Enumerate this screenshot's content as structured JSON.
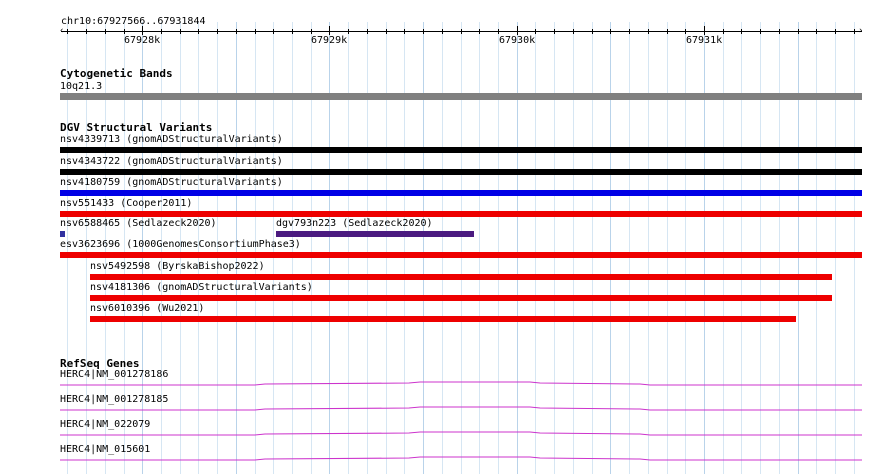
{
  "ruler": {
    "location": "chr10:67927566..67931844",
    "ticks": [
      {
        "label": "67928k",
        "pos": 67928000
      },
      {
        "label": "67929k",
        "pos": 67929000
      },
      {
        "label": "67930k",
        "pos": 67930000
      },
      {
        "label": "67931k",
        "pos": 67931000
      }
    ],
    "view_start": 67927566,
    "view_end": 67931844
  },
  "tracks": {
    "cytoband": {
      "title": "Cytogenetic Bands",
      "band_label": "10q21.3",
      "color": "#808080"
    },
    "dgv": {
      "title": "DGV Structural Variants",
      "features": [
        {
          "label": "nsv4339713 (gnomADStructuralVariants)",
          "start": 67927400,
          "end": 67931900,
          "color": "#000000",
          "row": 0
        },
        {
          "label": "nsv4343722 (gnomADStructuralVariants)",
          "start": 67927400,
          "end": 67931900,
          "color": "#000000",
          "row": 1
        },
        {
          "label": "nsv4180759 (gnomADStructuralVariants)",
          "start": 67927400,
          "end": 67931900,
          "color": "#0000e6",
          "row": 2
        },
        {
          "label": "nsv551433 (Cooper2011)",
          "start": 67927400,
          "end": 67931900,
          "color": "#ee0000",
          "row": 3
        },
        {
          "label": "nsv6588465 (Sedlazeck2020)",
          "start": 67927550,
          "end": 67927590,
          "color": "#3030a0",
          "row": 4
        },
        {
          "label": "dgv793n223 (Sedlazeck2020)",
          "start": 67928714,
          "end": 67929772,
          "color": "#4b1a80",
          "row": 4
        },
        {
          "label": "esv3623696 (1000GenomesConsortiumPhase3)",
          "start": 67927400,
          "end": 67931900,
          "color": "#ee0000",
          "row": 5
        },
        {
          "label": "nsv5492598 (ByrskaBishop2022)",
          "start": 67927722,
          "end": 67931682,
          "color": "#ee0000",
          "row": 6
        },
        {
          "label": "nsv4181306 (gnomADStructuralVariants)",
          "start": 67927722,
          "end": 67931682,
          "color": "#ee0000",
          "row": 7
        },
        {
          "label": "nsv6010396 (Wu2021)",
          "start": 67927722,
          "end": 67931490,
          "color": "#ee0000",
          "row": 8
        }
      ]
    },
    "refseq": {
      "title": "RefSeq Genes",
      "color": "#cc33cc",
      "genes": [
        {
          "label": "HERC4|NM_001278186"
        },
        {
          "label": "HERC4|NM_001278185"
        },
        {
          "label": "HERC4|NM_022079"
        },
        {
          "label": "HERC4|NM_015601"
        }
      ]
    }
  }
}
